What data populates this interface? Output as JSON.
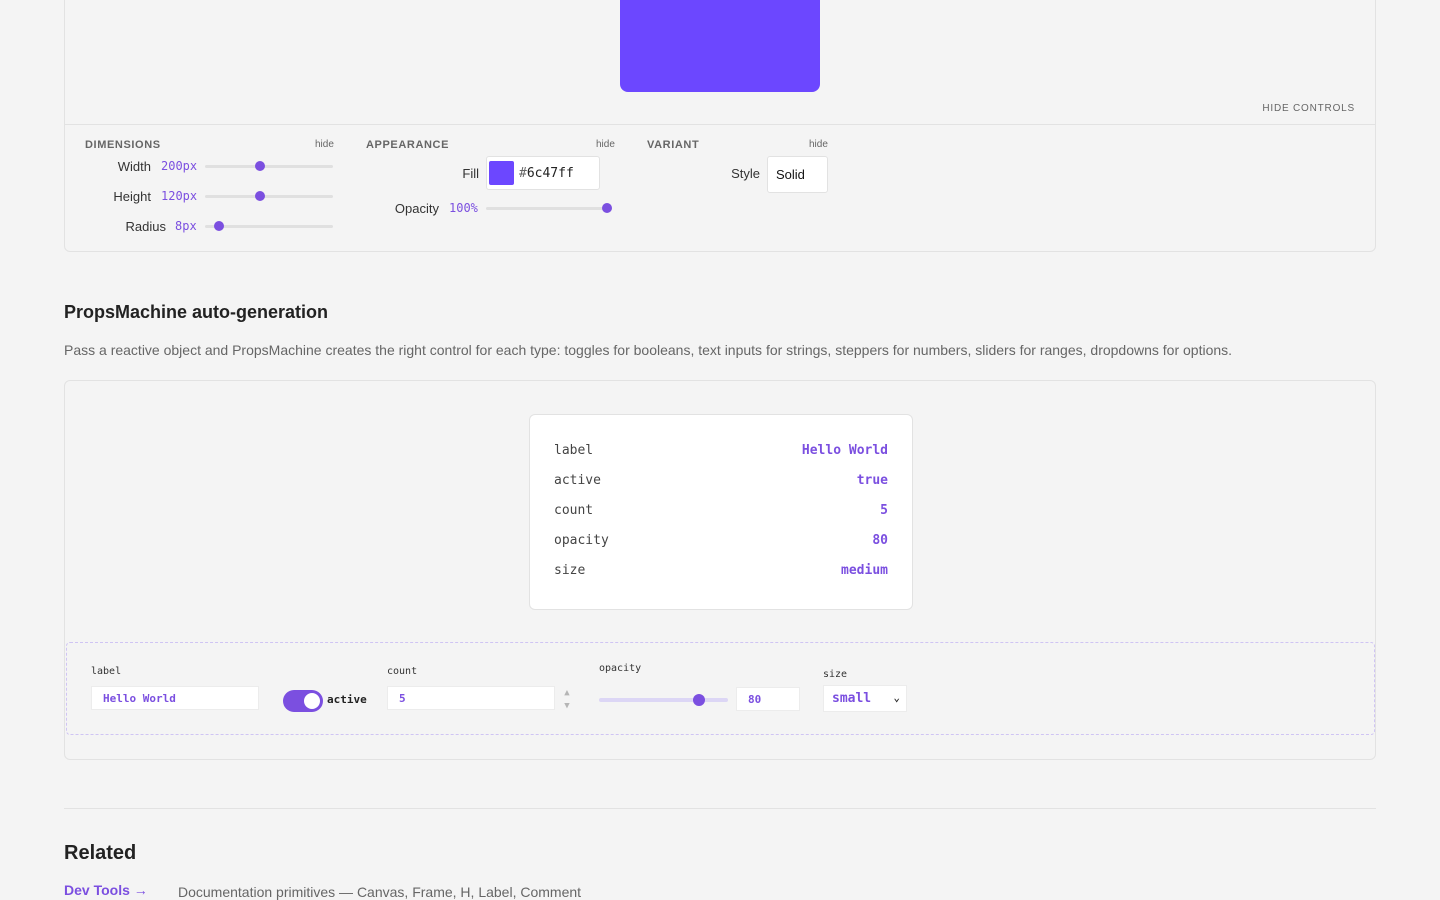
{
  "canvas": {
    "preview_color": "#6c47ff",
    "hide_controls": "HIDE CONTROLS",
    "dimensions": {
      "heading": "DIMENSIONS",
      "hide": "hide",
      "width_label": "Width",
      "width_value": "200px",
      "width_level": 0.42,
      "height_label": "Height",
      "height_value": "120px",
      "height_level": 0.42,
      "radius_label": "Radius",
      "radius_value": "8px",
      "radius_level": 0.08
    },
    "appearance": {
      "heading": "APPEARANCE",
      "hide": "hide",
      "fill_label": "Fill",
      "fill_hash": "#",
      "fill_value": "6c47ff",
      "opacity_label": "Opacity",
      "opacity_value": "100%",
      "opacity_level": 1.0
    },
    "variant": {
      "heading": "VARIANT",
      "hide": "hide",
      "style_label": "Style",
      "style_value": "Solid"
    }
  },
  "propsmachine": {
    "title": "PropsMachine auto-generation",
    "description": "Pass a reactive object and PropsMachine creates the right control for each type: toggles for booleans, text inputs for strings, steppers for numbers, sliders for ranges, dropdowns for options.",
    "props": [
      {
        "key": "label",
        "value": "Hello World"
      },
      {
        "key": "active",
        "value": "true"
      },
      {
        "key": "count",
        "value": "5"
      },
      {
        "key": "opacity",
        "value": "80"
      },
      {
        "key": "size",
        "value": "medium"
      }
    ],
    "controls": {
      "label_caption": "label",
      "label_value": "Hello World",
      "active_caption": "active",
      "active_on": true,
      "count_caption": "count",
      "count_value": "5",
      "stepper_up": "▲",
      "stepper_down": "▼",
      "opacity_caption": "opacity",
      "opacity_value": "80",
      "opacity_level": 0.8,
      "size_caption": "size",
      "size_value": "small",
      "size_chevron": "⌄"
    }
  },
  "related": {
    "title": "Related",
    "link": "Dev Tools →",
    "description": "Documentation primitives — Canvas, Frame, H, Label, Comment"
  }
}
